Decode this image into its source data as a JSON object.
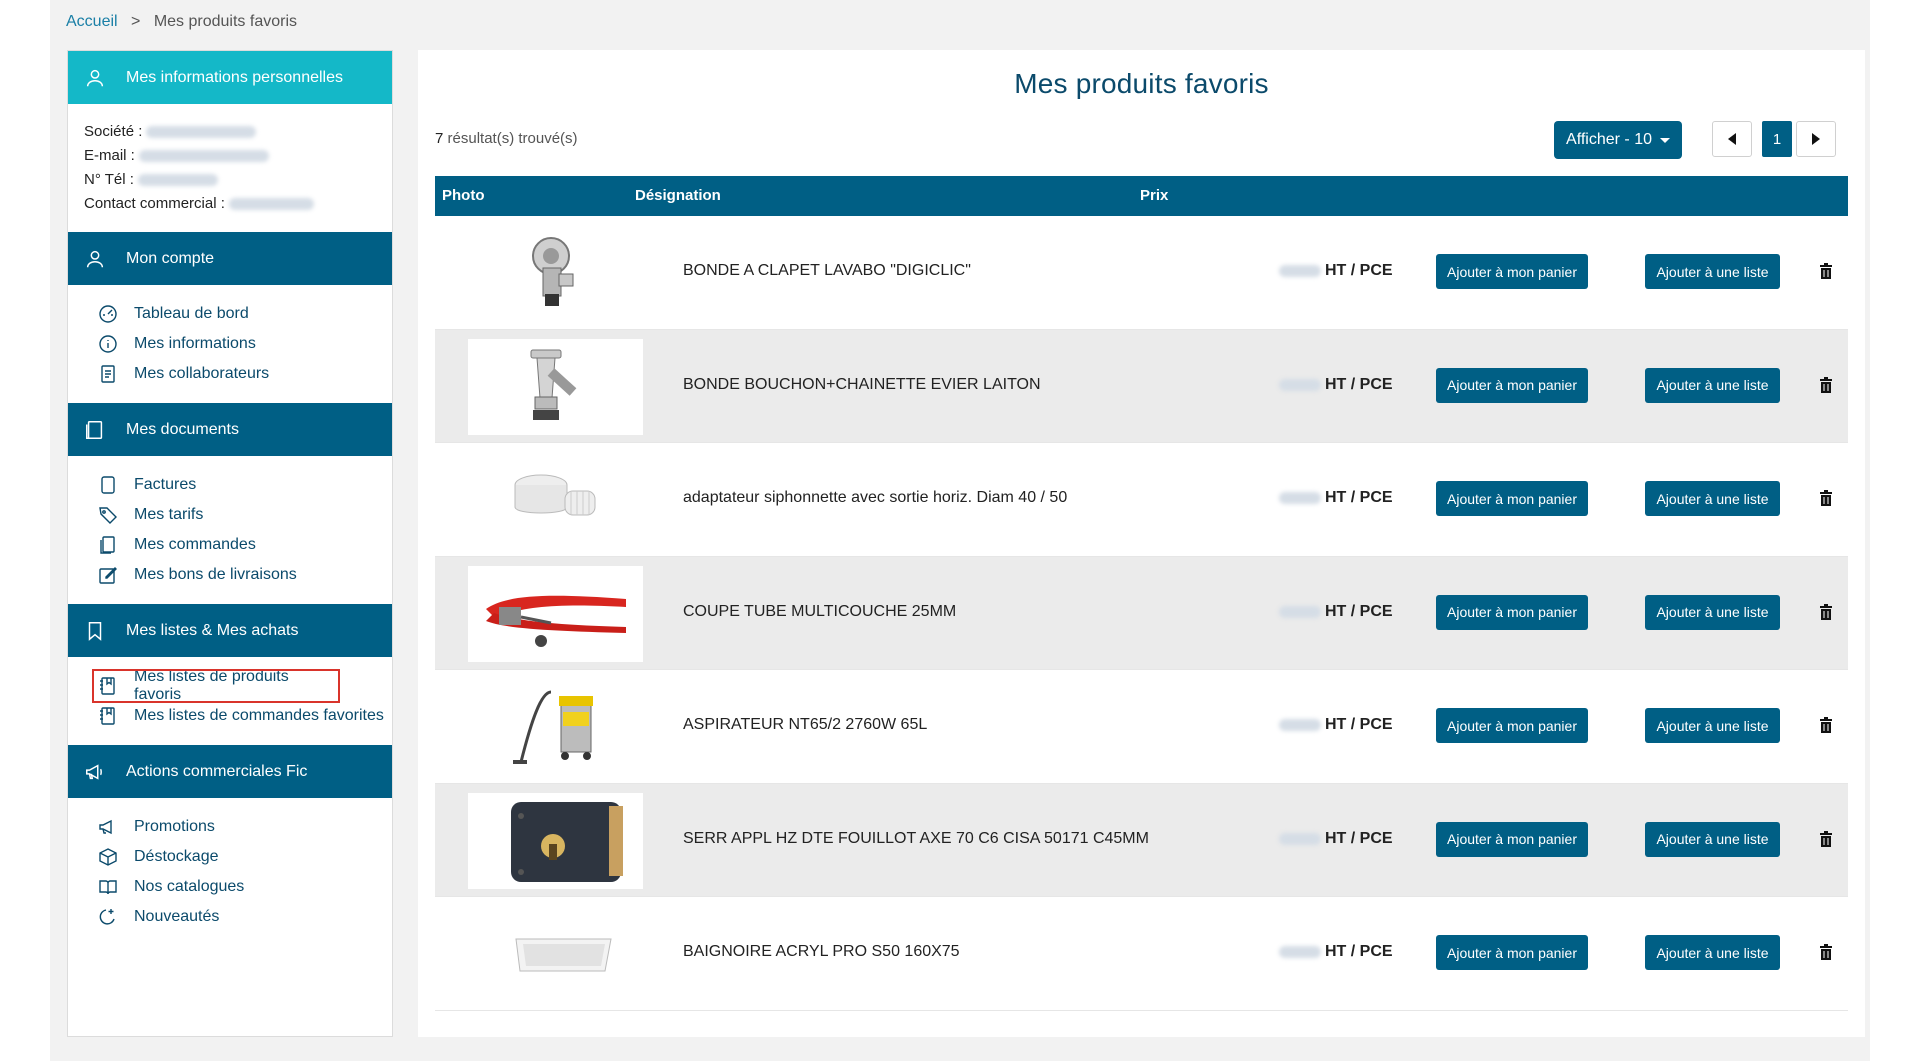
{
  "breadcrumb": {
    "home": "Accueil",
    "separator": ">",
    "current": "Mes produits favoris"
  },
  "sidebar": {
    "personal": {
      "title": "Mes informations personnelles",
      "labels": {
        "company": "Société :",
        "email": "E-mail :",
        "phone": "N° Tél :",
        "contact": "Contact commercial :"
      }
    },
    "account": {
      "title": "Mon compte",
      "items": [
        {
          "label": "Tableau de bord",
          "icon": "dashboard-icon"
        },
        {
          "label": "Mes informations",
          "icon": "info-icon"
        },
        {
          "label": "Mes collaborateurs",
          "icon": "contacts-icon"
        }
      ]
    },
    "documents": {
      "title": "Mes documents",
      "items": [
        {
          "label": "Factures",
          "icon": "invoice-icon"
        },
        {
          "label": "Mes tarifs",
          "icon": "tag-icon"
        },
        {
          "label": "Mes commandes",
          "icon": "orders-icon"
        },
        {
          "label": "Mes bons de livraisons",
          "icon": "edit-icon"
        }
      ]
    },
    "lists": {
      "title": "Mes listes & Mes achats",
      "items": [
        {
          "label": "Mes listes de produits favoris",
          "icon": "list-icon",
          "active": true
        },
        {
          "label": "Mes listes de commandes favorites",
          "icon": "list-icon"
        }
      ]
    },
    "commercial": {
      "title": "Actions commerciales Fic",
      "items": [
        {
          "label": "Promotions",
          "icon": "megaphone-icon"
        },
        {
          "label": "Déstockage",
          "icon": "box-icon"
        },
        {
          "label": "Nos catalogues",
          "icon": "book-icon"
        },
        {
          "label": "Nouveautés",
          "icon": "new-icon"
        }
      ]
    }
  },
  "main": {
    "title": "Mes produits favoris",
    "results_count": "7",
    "results_text": "résultat(s) trouvé(s)",
    "show_label": "Afficher - 10",
    "current_page": "1",
    "columns": {
      "photo": "Photo",
      "designation": "Désignation",
      "price": "Prix"
    },
    "price_unit": "HT / PCE",
    "cart_button": "Ajouter à mon panier",
    "list_button": "Ajouter à une liste",
    "products": [
      {
        "designation": "BONDE A CLAPET LAVABO \"DIGICLIC\"",
        "image": "valve"
      },
      {
        "designation": "BONDE BOUCHON+CHAINETTE EVIER LAITON",
        "image": "drain"
      },
      {
        "designation": "adaptateur siphonnette avec sortie horiz. Diam 40 / 50",
        "image": "adapter"
      },
      {
        "designation": "COUPE TUBE MULTICOUCHE 25MM",
        "image": "cutter"
      },
      {
        "designation": "ASPIRATEUR NT65/2 2760W 65L",
        "image": "vacuum"
      },
      {
        "designation": "SERR APPL HZ DTE FOUILLOT AXE 70 C6 CISA 50171 C45MM",
        "image": "lock"
      },
      {
        "designation": "BAIGNOIRE ACRYL PRO S50 160X75",
        "image": "bathtub"
      }
    ]
  },
  "colors": {
    "primary": "#005f85",
    "teal": "#14b8c8",
    "active_outline": "#d9342b"
  }
}
